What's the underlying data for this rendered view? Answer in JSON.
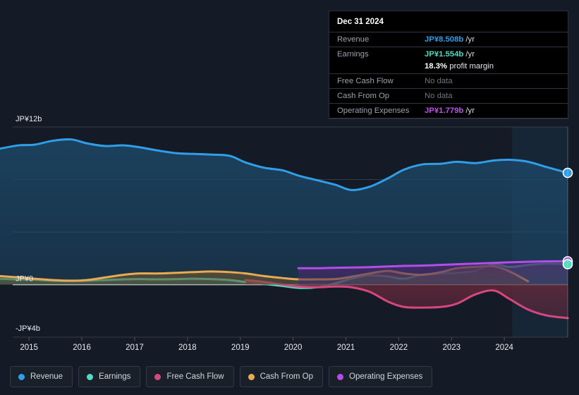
{
  "tooltip": {
    "date": "Dec 31 2024",
    "rows": [
      {
        "label": "Revenue",
        "value": "JP¥8.508b",
        "suffix": "/yr",
        "color": "#2f9fe8",
        "nodata": false
      },
      {
        "label": "Earnings",
        "value": "JP¥1.554b",
        "suffix": "/yr",
        "color": "#4fdcc2",
        "nodata": false
      },
      {
        "label": "Free Cash Flow",
        "value": "No data",
        "suffix": "",
        "color": "#6f757f",
        "nodata": true
      },
      {
        "label": "Cash From Op",
        "value": "No data",
        "suffix": "",
        "color": "#6f757f",
        "nodata": true
      },
      {
        "label": "Operating Expenses",
        "value": "JP¥1.779b",
        "suffix": "/yr",
        "color": "#c050f0",
        "nodata": false
      }
    ],
    "profit_margin_pct": "18.3%",
    "profit_margin_text": "profit margin"
  },
  "legend": {
    "items": [
      {
        "label": "Revenue",
        "color": "#2f9fe8"
      },
      {
        "label": "Earnings",
        "color": "#4fdcc2"
      },
      {
        "label": "Free Cash Flow",
        "color": "#d6477f"
      },
      {
        "label": "Cash From Op",
        "color": "#e8aa52"
      },
      {
        "label": "Operating Expenses",
        "color": "#b44de8"
      }
    ]
  },
  "chart_data": {
    "type": "area",
    "title": "",
    "xlabel": "",
    "ylabel": "",
    "ylim": [
      -4,
      12
    ],
    "yticks": [
      12,
      8,
      4,
      0,
      -4
    ],
    "ytick_labels": [
      "JP¥12b",
      "",
      "",
      "JP¥0",
      "-JP¥4b"
    ],
    "ytick_labels_shown": [
      "JP¥12b",
      "JP¥0",
      "-JP¥4b"
    ],
    "grid": true,
    "legend_position": "bottom",
    "currency": "JP¥",
    "units": "b",
    "xticks": [
      2015,
      2016,
      2017,
      2018,
      2019,
      2020,
      2021,
      2022,
      2023,
      2024
    ],
    "xlim": [
      2014.45,
      2025.2
    ],
    "forecast_band_start": 2024.15,
    "series": [
      {
        "name": "Revenue",
        "color": "#2f9fe8",
        "fill": "#1d4a6b",
        "x": [
          2014.45,
          2014.8,
          2015.1,
          2015.45,
          2015.8,
          2016.1,
          2016.45,
          2016.8,
          2017.1,
          2017.45,
          2017.8,
          2018.1,
          2018.45,
          2018.8,
          2019.1,
          2019.45,
          2019.8,
          2020.1,
          2020.45,
          2020.8,
          2021.1,
          2021.45,
          2021.8,
          2022.1,
          2022.45,
          2022.8,
          2023.1,
          2023.45,
          2023.8,
          2024.1,
          2024.45,
          2024.8,
          2025.2
        ],
        "values": [
          10.35,
          10.6,
          10.65,
          10.95,
          11.05,
          10.75,
          10.55,
          10.6,
          10.45,
          10.2,
          10.0,
          9.95,
          9.9,
          9.8,
          9.3,
          8.9,
          8.7,
          8.3,
          7.95,
          7.6,
          7.2,
          7.45,
          8.1,
          8.75,
          9.15,
          9.2,
          9.35,
          9.25,
          9.45,
          9.5,
          9.35,
          8.95,
          8.508
        ]
      },
      {
        "name": "Earnings",
        "color": "#4fdcc2",
        "fill": "#2f6b66",
        "x": [
          2014.45,
          2014.8,
          2015.1,
          2015.45,
          2015.8,
          2016.1,
          2016.45,
          2016.8,
          2017.1,
          2017.45,
          2017.8,
          2018.1,
          2018.45,
          2018.8,
          2019.1,
          2019.45,
          2019.8,
          2020.1,
          2020.45,
          2020.8,
          2021.1,
          2021.45,
          2021.8,
          2022.1,
          2022.45,
          2022.8,
          2023.1,
          2023.45,
          2023.8,
          2024.1,
          2024.45,
          2024.8,
          2025.2
        ],
        "values": [
          0.45,
          0.4,
          0.38,
          0.3,
          0.28,
          0.3,
          0.35,
          0.4,
          0.42,
          0.4,
          0.42,
          0.45,
          0.42,
          0.35,
          0.2,
          0.05,
          -0.1,
          -0.25,
          -0.2,
          0.1,
          0.45,
          0.7,
          0.62,
          0.45,
          0.75,
          0.85,
          0.9,
          1.05,
          1.55,
          1.35,
          1.5,
          1.6,
          1.554
        ]
      },
      {
        "name": "Free Cash Flow",
        "color": "#d6477f",
        "fill": "#6b2a3c",
        "x": [
          2019.1,
          2019.45,
          2019.8,
          2020.1,
          2020.45,
          2020.8,
          2021.1,
          2021.45,
          2021.8,
          2022.1,
          2022.45,
          2022.8,
          2023.1,
          2023.45,
          2023.8,
          2024.1,
          2024.45,
          2024.8,
          2025.2
        ],
        "values": [
          0.35,
          0.2,
          0.0,
          -0.15,
          -0.2,
          -0.15,
          -0.2,
          -0.55,
          -1.3,
          -1.7,
          -1.75,
          -1.7,
          -1.45,
          -0.75,
          -0.45,
          -1.1,
          -1.9,
          -2.35,
          -2.55
        ]
      },
      {
        "name": "Cash From Op",
        "color": "#e8aa52",
        "fill": "#6b5530",
        "x": [
          2014.45,
          2014.8,
          2015.1,
          2015.45,
          2015.8,
          2016.1,
          2016.45,
          2016.8,
          2017.1,
          2017.45,
          2017.8,
          2018.1,
          2018.45,
          2018.8,
          2019.1,
          2019.45,
          2019.8,
          2020.1,
          2020.45,
          2020.8,
          2021.1,
          2021.45,
          2021.8,
          2022.1,
          2022.45,
          2022.8,
          2023.1,
          2023.45,
          2023.8,
          2024.1,
          2024.45
        ],
        "values": [
          0.65,
          0.55,
          0.45,
          0.35,
          0.3,
          0.35,
          0.55,
          0.75,
          0.85,
          0.85,
          0.9,
          0.95,
          1.0,
          0.95,
          0.85,
          0.65,
          0.5,
          0.4,
          0.4,
          0.42,
          0.6,
          0.85,
          1.05,
          0.85,
          0.75,
          0.95,
          1.25,
          1.35,
          1.4,
          1.0,
          0.25
        ]
      },
      {
        "name": "Operating Expenses",
        "color": "#b44de8",
        "fill": "#4a2a6b",
        "x": [
          2020.1,
          2020.45,
          2020.8,
          2021.1,
          2021.45,
          2021.8,
          2022.1,
          2022.45,
          2022.8,
          2023.1,
          2023.45,
          2023.8,
          2024.1,
          2024.45,
          2024.8,
          2025.2
        ],
        "values": [
          1.25,
          1.25,
          1.28,
          1.3,
          1.33,
          1.38,
          1.42,
          1.45,
          1.5,
          1.55,
          1.6,
          1.65,
          1.7,
          1.74,
          1.77,
          1.779
        ]
      }
    ],
    "end_markers": [
      {
        "name": "Revenue",
        "color": "#2f9fe8",
        "x": 2025.2,
        "y": 8.508
      },
      {
        "name": "Operating Expenses",
        "color": "#b44de8",
        "x": 2025.2,
        "y": 1.779
      },
      {
        "name": "Earnings",
        "color": "#4fdcc2",
        "x": 2025.2,
        "y": 1.554
      }
    ]
  }
}
